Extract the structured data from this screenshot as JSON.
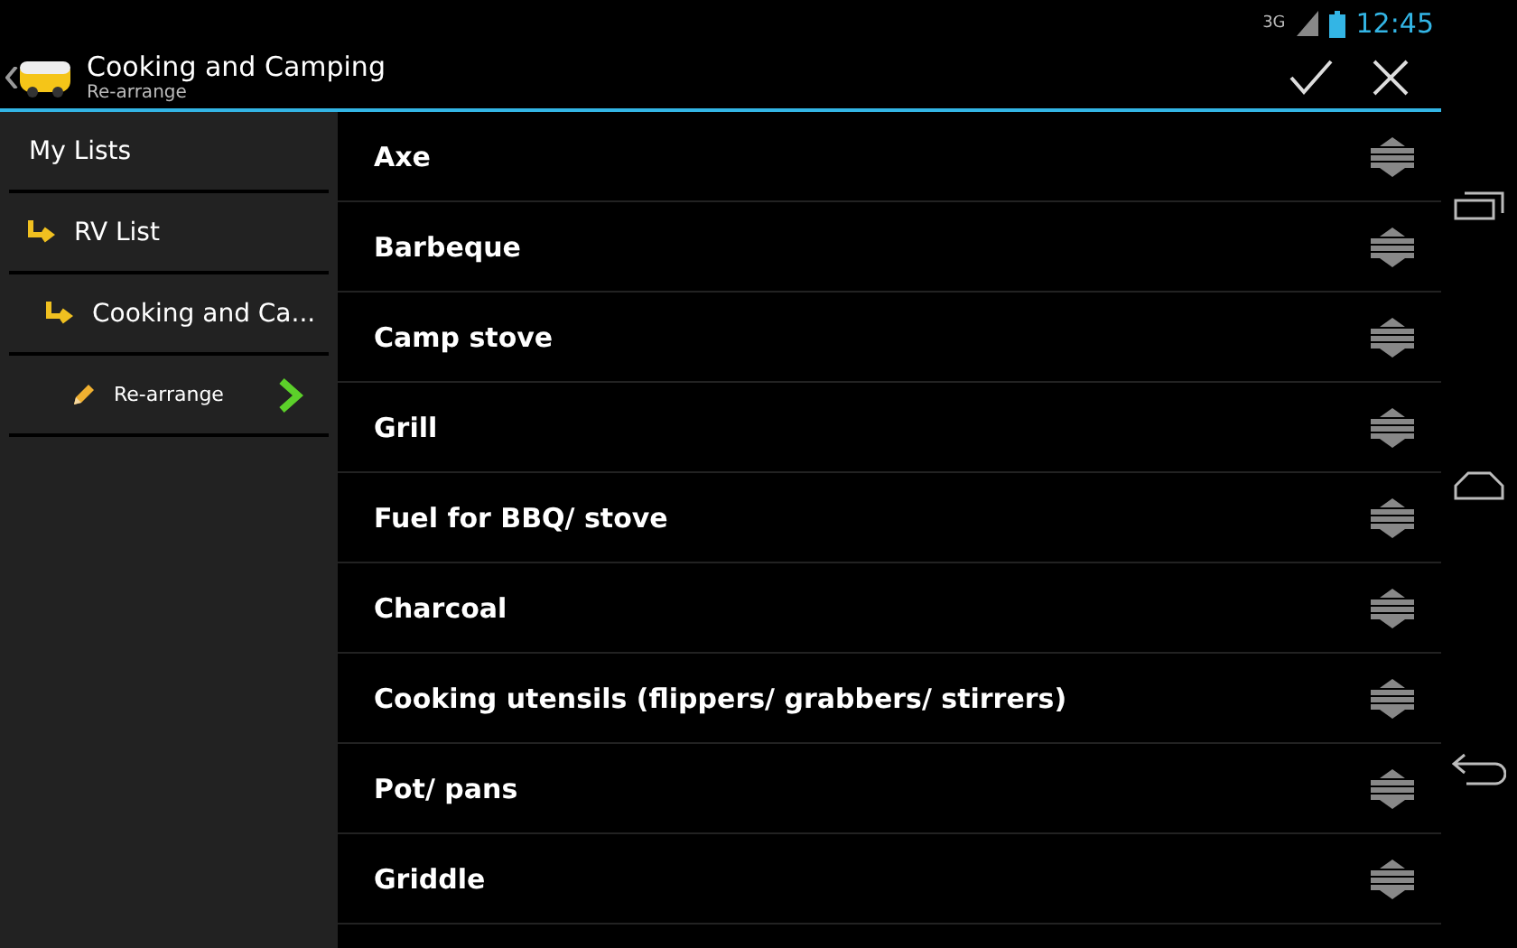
{
  "status_bar": {
    "network": "3G",
    "time": "12:45"
  },
  "action_bar": {
    "title": "Cooking and Camping",
    "subtitle": "Re-arrange"
  },
  "sidebar": {
    "items": [
      {
        "kind": "header",
        "label": "My Lists"
      },
      {
        "kind": "folder",
        "label": "RV List"
      },
      {
        "kind": "subfolder",
        "label": "Cooking and Ca..."
      },
      {
        "kind": "action",
        "label": "Re-arrange",
        "selected": true
      }
    ]
  },
  "items": [
    {
      "label": "Axe"
    },
    {
      "label": "Barbeque"
    },
    {
      "label": "Camp stove"
    },
    {
      "label": "Grill"
    },
    {
      "label": "Fuel for BBQ/ stove"
    },
    {
      "label": "Charcoal"
    },
    {
      "label": "Cooking utensils (flippers/ grabbers/ stirrers)"
    },
    {
      "label": "Pot/ pans"
    },
    {
      "label": "Griddle"
    }
  ]
}
